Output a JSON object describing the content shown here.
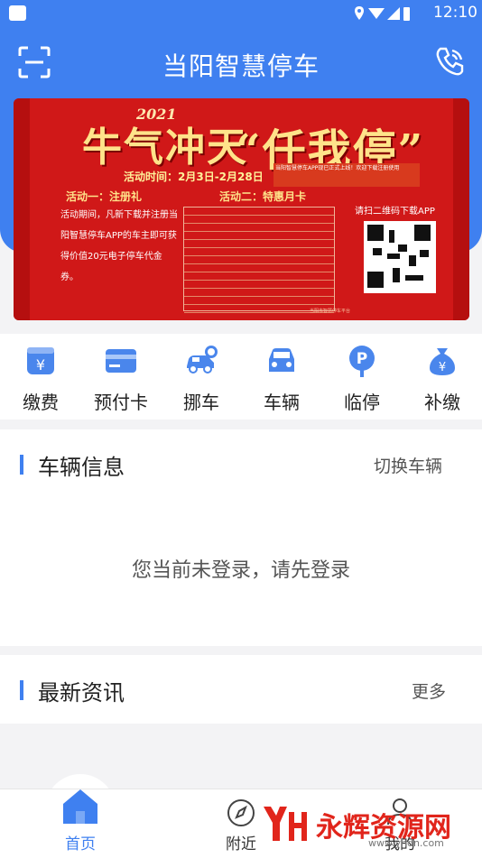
{
  "status_bar": {
    "time": "12:10"
  },
  "header": {
    "title": "当阳智慧停车",
    "scan_icon": "scan-icon",
    "phone_icon": "phone-icon"
  },
  "banner": {
    "year": "2021",
    "slogan": "牛气冲天",
    "headline": "“任我停”",
    "time": "活动时间：2月3日-2月28日",
    "note": "当阳智慧停车APP现已正式上线！欢迎下载注册使用",
    "act1": "活动一：注册礼",
    "act2": "活动二：特惠月卡",
    "act1_body": "活动期间，凡新下载并注册当阳智慧停车APP的车主即可获得价值20元电子停车代金券。",
    "scan_text": "请扫二维码下载APP",
    "footer": "当阳市智慧停车平台"
  },
  "menu": [
    {
      "label": "缴费",
      "icon": "yuan-card-icon"
    },
    {
      "label": "预付卡",
      "icon": "card-icon"
    },
    {
      "label": "挪车",
      "icon": "move-car-icon"
    },
    {
      "label": "车辆",
      "icon": "car-icon"
    },
    {
      "label": "临停",
      "icon": "parking-icon"
    },
    {
      "label": "补缴",
      "icon": "money-bag-icon"
    }
  ],
  "vehicle": {
    "title": "车辆信息",
    "switch": "切换车辆",
    "empty": "您当前未登录，请先登录"
  },
  "news": {
    "title": "最新资讯",
    "more": "更多"
  },
  "tabs": [
    {
      "label": "首页",
      "icon": "home-icon"
    },
    {
      "label": "附近",
      "icon": "compass-icon"
    },
    {
      "label": "我的",
      "icon": "user-icon"
    }
  ],
  "watermark": {
    "text": "永辉资源网",
    "url": "www.yhdn.com"
  },
  "colors": {
    "primary": "#3f80f0",
    "banner_red": "#d01818"
  }
}
